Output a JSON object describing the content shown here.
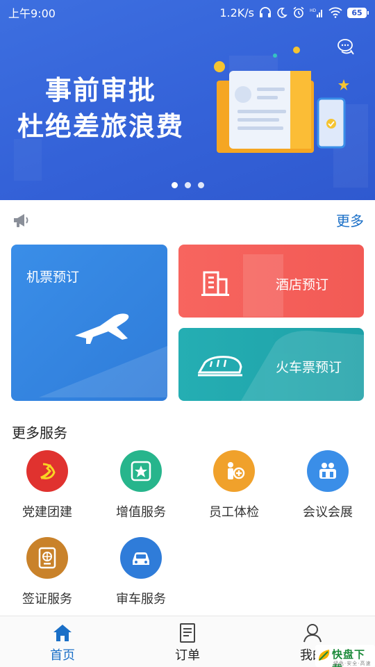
{
  "status_bar": {
    "time": "上午9:00",
    "network_speed": "1.2K/s",
    "battery": "65"
  },
  "banner": {
    "title_line1": "事前审批",
    "title_line2": "杜绝差旅浪费",
    "page_count": 3,
    "active_page": 1
  },
  "notice": {
    "more_label": "更多"
  },
  "cards": {
    "flight": "机票预订",
    "hotel": "酒店预订",
    "train": "火车票预订"
  },
  "services": {
    "title": "更多服务",
    "items": [
      {
        "label": "党建团建",
        "color": "#e0322f",
        "icon": "party-emblem-icon"
      },
      {
        "label": "增值服务",
        "color": "#27b58c",
        "icon": "star-badge-icon"
      },
      {
        "label": "员工体检",
        "color": "#f0a12b",
        "icon": "health-check-icon"
      },
      {
        "label": "会议会展",
        "color": "#3a8ee8",
        "icon": "meeting-icon"
      },
      {
        "label": "签证服务",
        "color": "#c9822a",
        "icon": "passport-icon"
      },
      {
        "label": "审车服务",
        "color": "#2f7cd9",
        "icon": "car-icon"
      }
    ]
  },
  "bottom_nav": {
    "home": "首页",
    "orders": "订单",
    "mine": "我的"
  },
  "watermark": {
    "text": "快盘下载",
    "sub": "绿色·安全·高速"
  },
  "colors": {
    "accent": "#1a6fc7",
    "banner": "#3462d8",
    "hotel": "#f25a55",
    "train": "#1ea1a8"
  }
}
